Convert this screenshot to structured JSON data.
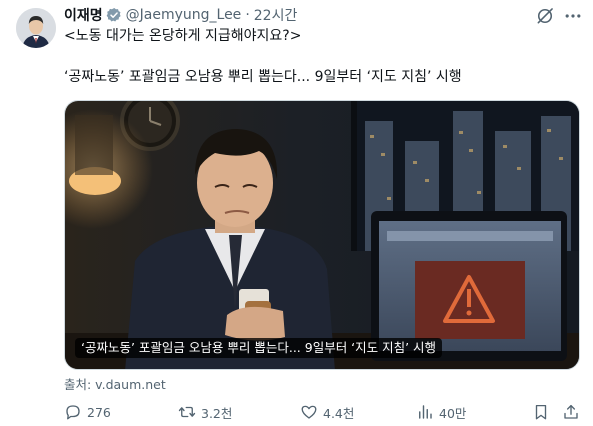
{
  "author": {
    "name": "이재명",
    "handle": "@Jaemyung_Lee",
    "separator": "·",
    "time": "22시간"
  },
  "tweet": {
    "line1": "<노동 대가는 온당하게 지급해야지요?>",
    "line2": "‘공짜노동’ 포괄임금 오남용 뿌리 뽑는다... 9일부터 ‘지도 지침’ 시행"
  },
  "card": {
    "caption": "‘공짜노동’ 포괄임금 오남용 뿌리 뽑는다... 9일부터 ‘지도 지침’ 시행",
    "source": "출처: v.daum.net"
  },
  "actions": {
    "replies": "276",
    "retweets": "3.2천",
    "likes": "4.4천",
    "views": "40만"
  },
  "icons": {
    "verified": "verified-badge-icon",
    "grok": "grok-icon",
    "more": "more-icon",
    "reply": "reply-icon",
    "retweet": "retweet-icon",
    "like": "heart-icon",
    "views": "views-icon",
    "bookmark": "bookmark-icon",
    "share": "share-icon"
  },
  "colors": {
    "text": "#0f1419",
    "secondary": "#536471",
    "verified": "#829aab",
    "warning": "#e06a3a"
  }
}
